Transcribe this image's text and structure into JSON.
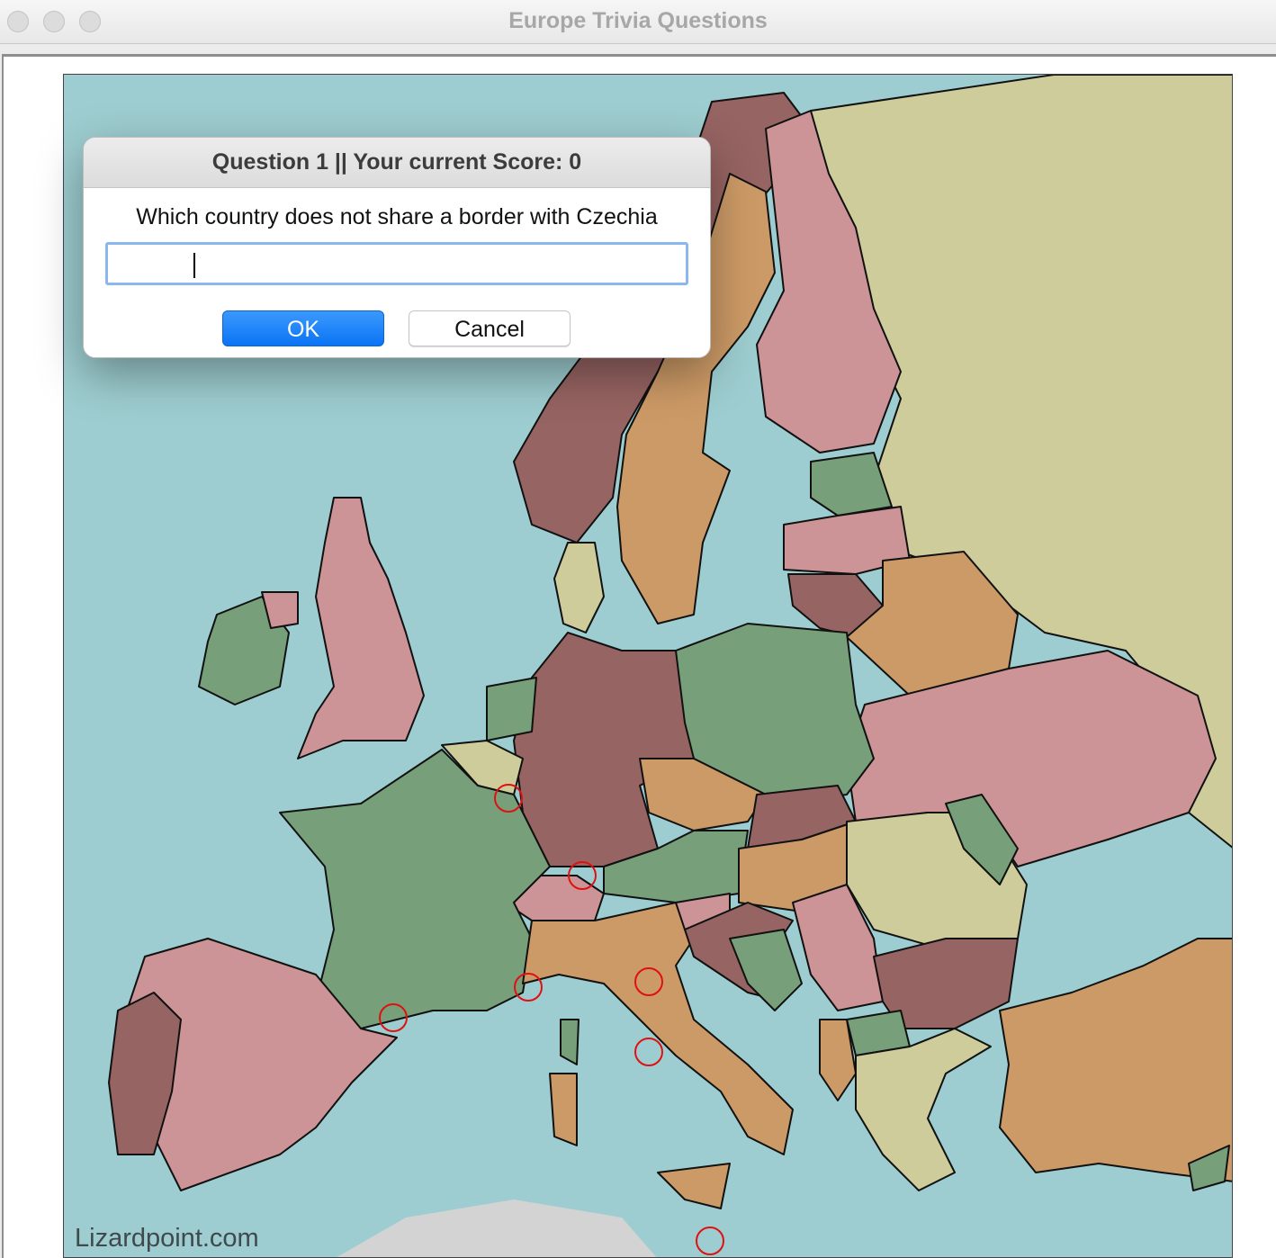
{
  "window": {
    "title": "Europe Trivia Questions"
  },
  "dialog": {
    "title": "Question 1 || Your current Score: 0",
    "question": "Which country does not share a border with Czechia",
    "answer_value": "",
    "ok_label": "OK",
    "cancel_label": "Cancel"
  },
  "map": {
    "credit": "Lizardpoint.com",
    "colors": {
      "sea": "#9dcdd0",
      "pink": "#cc9496",
      "maroon": "#966462",
      "green": "#77a07a",
      "tan": "#cc9a66",
      "khaki": "#cdcc9a",
      "land_gray": "#d3d3d3",
      "marker": "#e01010"
    }
  }
}
